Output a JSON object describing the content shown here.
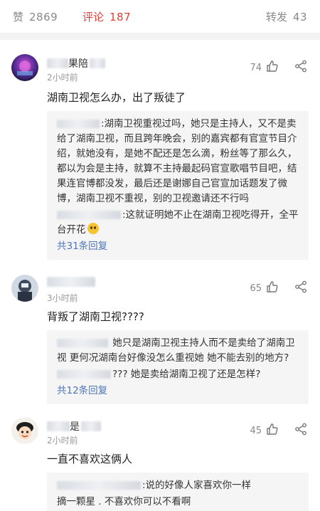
{
  "tabs": {
    "likes_label": "赞",
    "likes_count": "2869",
    "comments_label": "评论",
    "comments_count": "187",
    "shares_label": "转发",
    "shares_count": "43"
  },
  "comments": [
    {
      "username_visible": "果陪",
      "time": "2小时前",
      "likes": "74",
      "text": "湖南卫视怎么办，出了叛徒了",
      "replies": [
        ":湖南卫视重视过吗，她只是主持人，又不是卖给了湖南卫视，而且跨年晚会，别的嘉宾都有官宣节目介绍，就她没有，是她不配还是怎么滴，粉丝等了那么久，都以为会是主持，就算不主持最起码官宣歌唱节目吧，结果连官博都没发，最后还是谢娜自己官宣加话题发了微博，湖南卫视不重视，别的卫视邀请还不行吗",
        ":这就证明她不止在湖南卫视吃得开，全平台开花"
      ],
      "more": "共31条回复"
    },
    {
      "username_visible": "",
      "time": "3小时前",
      "likes": "65",
      "text": "背叛了湖南卫视????",
      "replies": [
        "她只是湖南卫视主持人而不是卖给了湖南卫视 更何况湖南台好像没怎么重视她 她不能去别的地方?",
        "??? 她是卖给湖南卫视了还是怎样?"
      ],
      "more": "共12条回复"
    },
    {
      "username_visible": "是",
      "time": "2小时前",
      "likes": "45",
      "text": "一直不喜欢这俩人",
      "replies": [
        ":说的好像人家喜欢你一样",
        "摘一颗星 . 不喜欢你可以不看啊"
      ],
      "more": ""
    }
  ],
  "icons": {
    "like": "thumbs-up-icon",
    "share": "share-icon"
  },
  "colors": {
    "accent": "#e0413a",
    "link": "#4f75b7"
  }
}
